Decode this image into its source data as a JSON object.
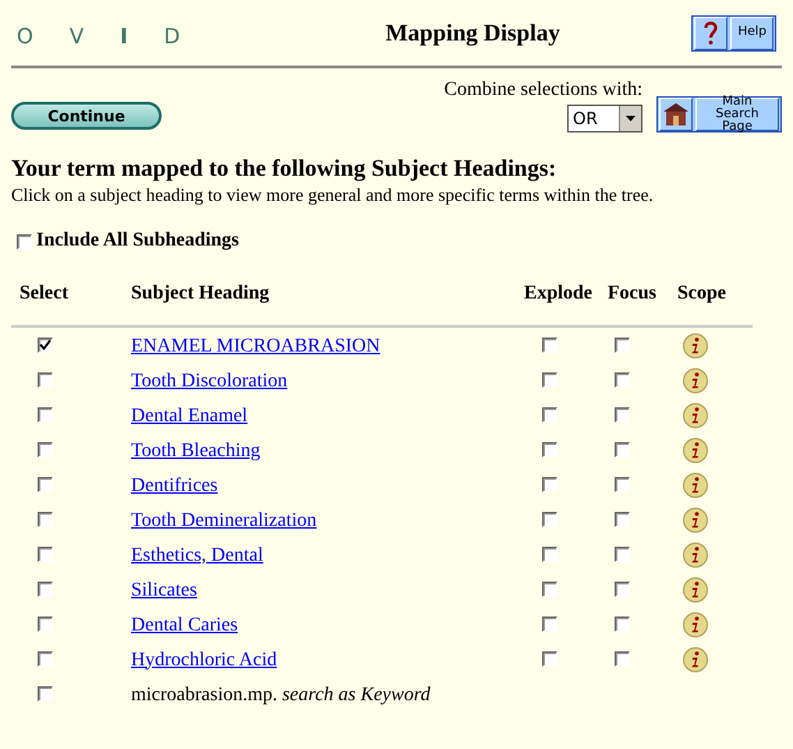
{
  "logo_letters": [
    "O",
    "V",
    "I",
    "D"
  ],
  "title": "Mapping Display",
  "help_button": {
    "label": "Help"
  },
  "continue_button": {
    "label": "Continue"
  },
  "combine": {
    "label": "Combine selections with:",
    "value": "OR"
  },
  "main_search_button": {
    "label": "Main Search Page"
  },
  "heading": "Your term mapped to the following Subject Headings:",
  "instructions": "Click on a subject heading to view more general and more specific terms within the tree.",
  "include_all": {
    "label": "Include All Subheadings",
    "checked": false
  },
  "columns": [
    "Select",
    "Subject Heading",
    "Explode",
    "Focus",
    "Scope"
  ],
  "rows": [
    {
      "kind": "heading",
      "checked": true,
      "term": "ENAMEL MICROABRASION",
      "explode": false,
      "focus": false
    },
    {
      "kind": "heading",
      "checked": false,
      "term": "Tooth Discoloration",
      "explode": false,
      "focus": false
    },
    {
      "kind": "heading",
      "checked": false,
      "term": "Dental Enamel",
      "explode": false,
      "focus": false
    },
    {
      "kind": "heading",
      "checked": false,
      "term": "Tooth Bleaching",
      "explode": false,
      "focus": false
    },
    {
      "kind": "heading",
      "checked": false,
      "term": "Dentifrices",
      "explode": false,
      "focus": false
    },
    {
      "kind": "heading",
      "checked": false,
      "term": "Tooth Demineralization",
      "explode": false,
      "focus": false
    },
    {
      "kind": "heading",
      "checked": false,
      "term": "Esthetics, Dental",
      "explode": false,
      "focus": false
    },
    {
      "kind": "heading",
      "checked": false,
      "term": "Silicates",
      "explode": false,
      "focus": false
    },
    {
      "kind": "heading",
      "checked": false,
      "term": "Dental Caries",
      "explode": false,
      "focus": false
    },
    {
      "kind": "heading",
      "checked": false,
      "term": "Hydrochloric Acid",
      "explode": false,
      "focus": false
    },
    {
      "kind": "keyword",
      "checked": false,
      "term": "microabrasion.mp. *search as Keyword*"
    }
  ]
}
